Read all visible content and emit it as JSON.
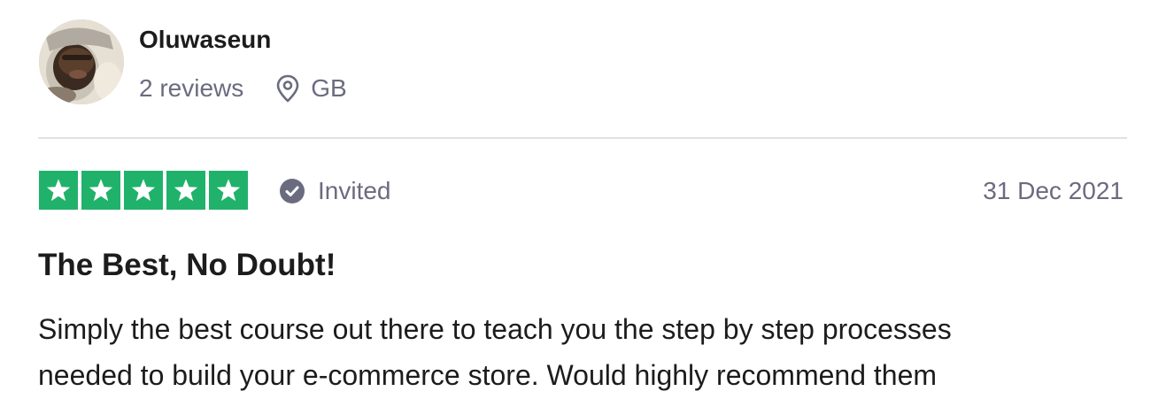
{
  "reviewer": {
    "name": "Oluwaseun",
    "reviews_count": "2 reviews",
    "country": "GB",
    "avatar_icon": "avatar-photo"
  },
  "review": {
    "rating": 5,
    "rating_max": 5,
    "status": "Invited",
    "date": "31 Dec 2021",
    "title": "The Best, No Doubt!",
    "body_lines": [
      "Simply the best course out there to teach you the step by step processes",
      "needed to build your e-commerce store. Would highly recommend them"
    ]
  },
  "colors": {
    "star_green": "#20b26b",
    "muted_text": "#6b6b80",
    "divider": "#e1e1e6",
    "badge": "#6b6b80"
  },
  "icons": {
    "location": "location-pin-icon",
    "verified": "checkmark-circle-icon",
    "star": "star-icon"
  }
}
